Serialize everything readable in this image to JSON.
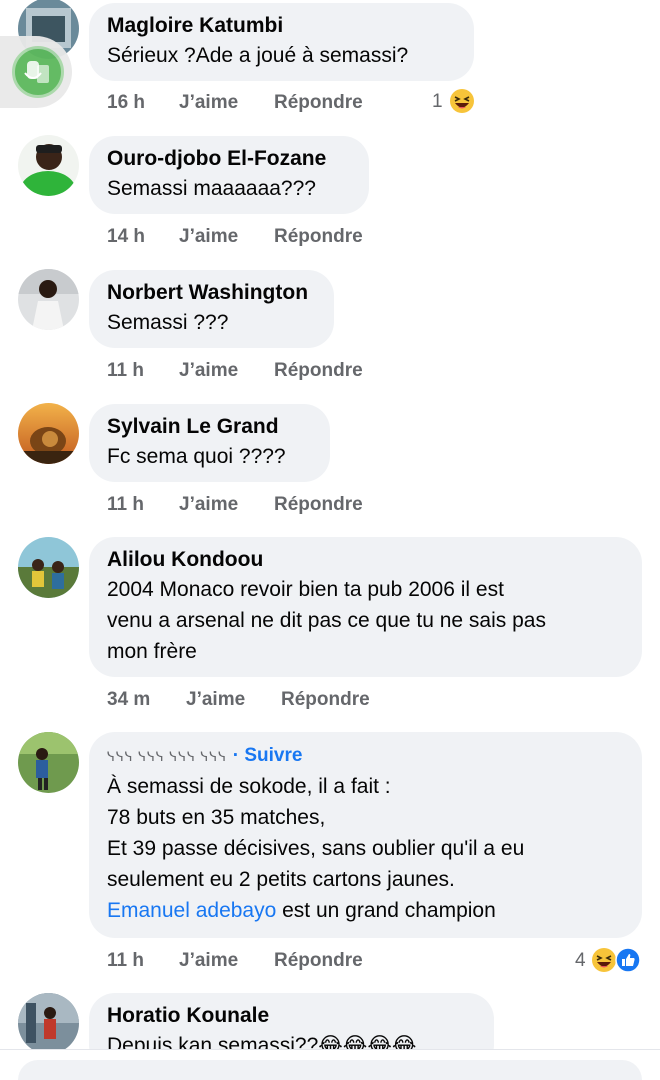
{
  "comments": [
    {
      "author": "Magloire Katumbi",
      "lines": [
        "Sérieux ?Ade a joué à semassi?"
      ],
      "time": "16 h",
      "like": "J’aime",
      "reply": "Répondre",
      "reactions": "1",
      "reaction_icons": [
        "laughing-emoji"
      ]
    },
    {
      "author": "Ouro-djobo El-Fozane",
      "lines": [
        "Semassi maaaaaa???"
      ],
      "time": "14 h",
      "like": "J’aime",
      "reply": "Répondre"
    },
    {
      "author": "Norbert Washington",
      "lines": [
        "Semassi ???"
      ],
      "time": "11 h",
      "like": "J’aime",
      "reply": "Répondre"
    },
    {
      "author": "Sylvain Le Grand",
      "lines": [
        "Fc sema quoi ????"
      ],
      "time": "11 h",
      "like": "J’aime",
      "reply": "Répondre"
    },
    {
      "author": "Alilou Kondoou",
      "lines": [
        "2004 Monaco revoir bien ta pub 2006 il est",
        "venu a arsenal ne dit pas ce que tu ne sais pas",
        "mon frère"
      ],
      "time": "34 m",
      "like": "J’aime",
      "reply": "Répondre"
    },
    {
      "author": "ᓭᓭᓭ ᓭᓭᓭ ᓭᓭᓭ ᓭᓭᓭ",
      "follow": "· Suivre",
      "lines": [
        "À semassi de sokode, il a fait :",
        "78 buts en 35 matches,",
        "Et 39 passe décisives, sans oublier qu'il a eu",
        "seulement eu 2 petits cartons jaunes."
      ],
      "mention": "Emanuel adebayo",
      "mention_rest": " est un grand champion",
      "time": "11 h",
      "like": "J’aime",
      "reply": "Répondre",
      "reactions": "4",
      "reaction_icons": [
        "laughing-emoji",
        "like-icon"
      ]
    },
    {
      "author": "Horatio Kounale",
      "lines": [
        "Depuis kan semassi??😂😂😂😂"
      ]
    }
  ],
  "colors": {
    "bubble": "#f0f2f5",
    "meta_text": "#65676b",
    "link": "#1877f2"
  }
}
